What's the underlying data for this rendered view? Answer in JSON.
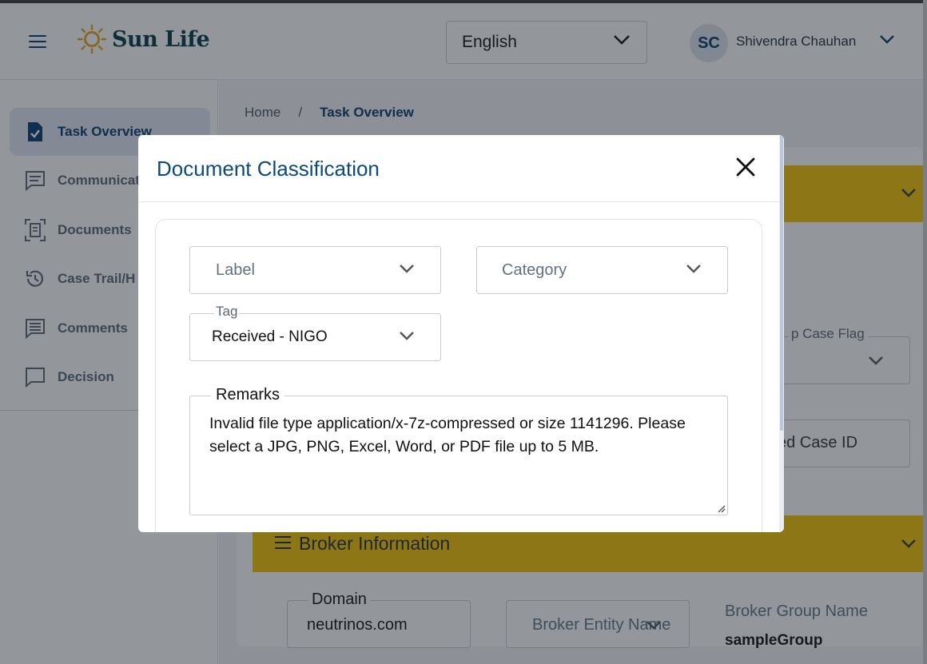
{
  "header": {
    "brand": "Sun Life",
    "language": "English",
    "user_initials": "SC",
    "user_name": "Shivendra Chauhan"
  },
  "sidebar": {
    "items": [
      {
        "label": "Task Overview",
        "icon": "task-check-icon"
      },
      {
        "label": "Communicat",
        "icon": "chat-icon"
      },
      {
        "label": "Documents",
        "icon": "document-scan-icon"
      },
      {
        "label": "Case Trail/H",
        "icon": "history-icon"
      },
      {
        "label": "Comments",
        "icon": "comment-icon"
      },
      {
        "label": "Decision",
        "icon": "decision-icon"
      }
    ]
  },
  "breadcrumb": {
    "home": "Home",
    "separator": "/",
    "current": "Task Overview"
  },
  "background": {
    "flag_label": "p Case Flag",
    "case_id_text": "ed Case ID",
    "broker_title": "Broker Information",
    "domain_label": "Domain",
    "domain_value": "neutrinos.com",
    "broker_entity_placeholder": "Broker Entity Name",
    "broker_group_label": "Broker Group Name",
    "broker_group_value": "sampleGroup"
  },
  "modal": {
    "title": "Document Classification",
    "label_placeholder": "Label",
    "category_placeholder": "Category",
    "tag_label": "Tag",
    "tag_value": "Received - NIGO",
    "remarks_label": "Remarks",
    "remarks_text": "Invalid file type application/x-7z-compressed or size 1141296. Please select a JPG, PNG, Excel, Word, or PDF file up to 5 MB."
  },
  "colors": {
    "brand_navy": "#003a6d",
    "accent_yellow": "#f2c200",
    "logo_gold": "#e8a317"
  }
}
